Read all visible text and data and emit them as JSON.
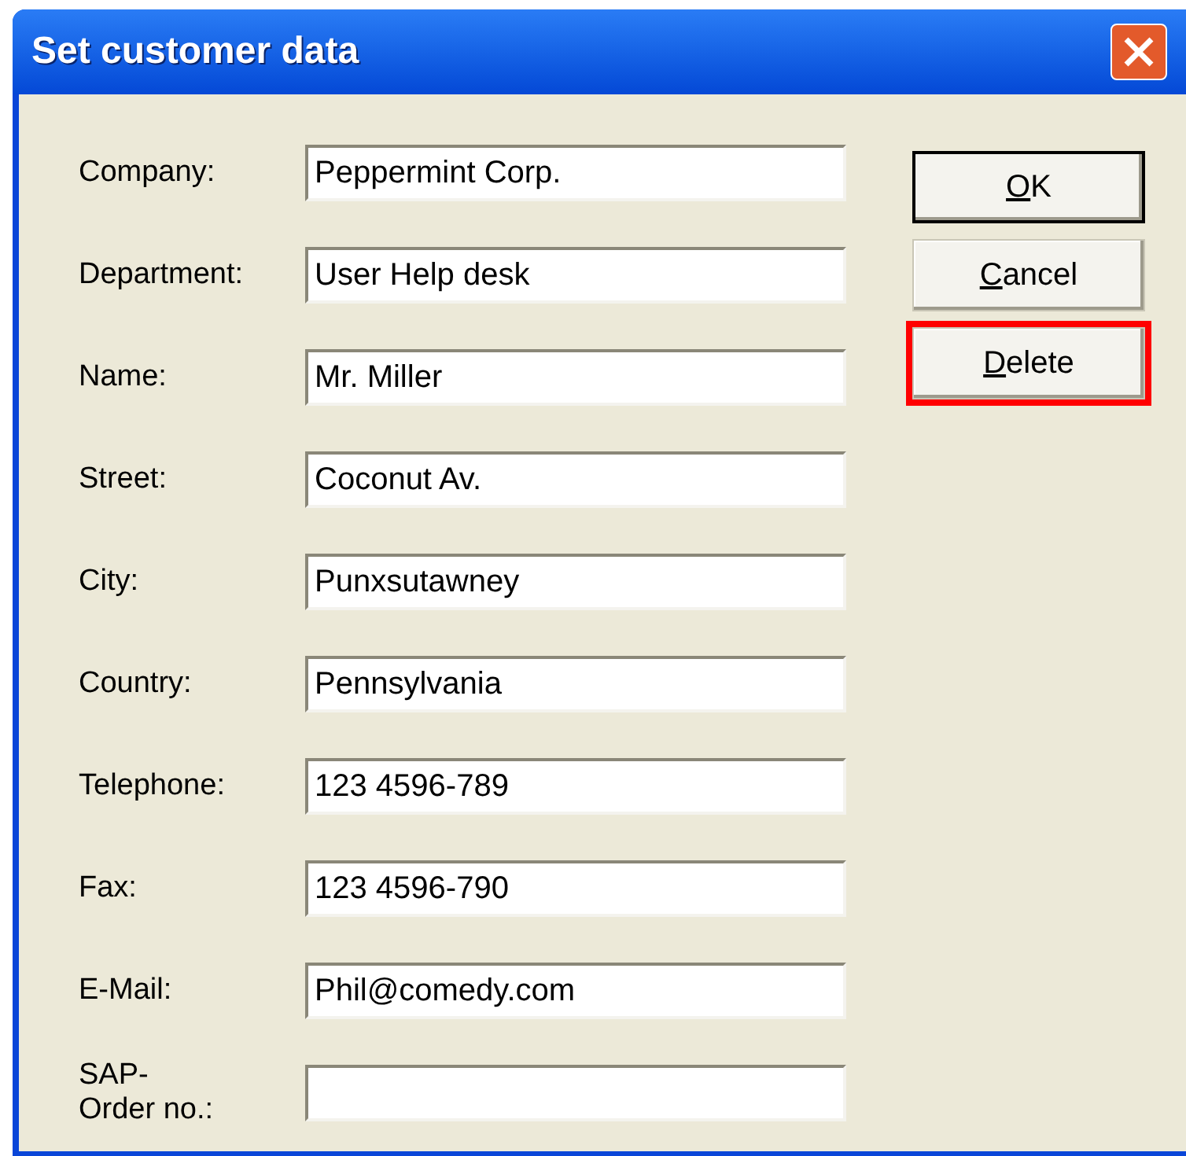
{
  "window": {
    "title": "Set customer data"
  },
  "fields": [
    {
      "label": "Company:",
      "value": "Peppermint Corp."
    },
    {
      "label": "Department:",
      "value": "User Help desk"
    },
    {
      "label": "Name:",
      "value": "Mr. Miller"
    },
    {
      "label": "Street:",
      "value": "Coconut Av."
    },
    {
      "label": "City:",
      "value": "Punxsutawney"
    },
    {
      "label": "Country:",
      "value": "Pennsylvania"
    },
    {
      "label": "Telephone:",
      "value": "123 4596-789"
    },
    {
      "label": "Fax:",
      "value": "123 4596-790"
    },
    {
      "label": "E-Mail:",
      "value": "Phil@comedy.com"
    },
    {
      "label": "SAP-\nOrder no.:"
    }
  ],
  "buttons": [
    {
      "label": "OK",
      "default": true,
      "highlighted": false,
      "underline_first": true
    },
    {
      "label": "Cancel",
      "default": false,
      "highlighted": false,
      "underline_first": true
    },
    {
      "label": "Delete",
      "default": false,
      "highlighted": true,
      "underline_first": true
    }
  ]
}
